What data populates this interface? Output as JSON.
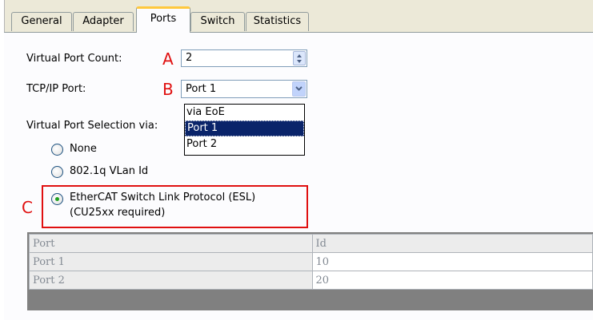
{
  "tabs": [
    "General",
    "Adapter",
    "Ports",
    "Switch",
    "Statistics"
  ],
  "active_tab": "Ports",
  "virtual_port_count": {
    "label": "Virtual Port Count:",
    "marker": "A",
    "value": "2"
  },
  "tcpip_port": {
    "label": "TCP/IP Port:",
    "marker": "B",
    "value": "Port 1"
  },
  "dropdown_options": [
    "via EoE",
    "Port 1",
    "Port 2"
  ],
  "dropdown_selected": "Port 1",
  "selection": {
    "label": "Virtual Port Selection via:",
    "options": [
      {
        "label": "None",
        "checked": false
      },
      {
        "label": "802.1q VLan Id",
        "checked": false
      },
      {
        "label": "EtherCAT Switch Link Protocol (ESL)",
        "sublabel": "(CU25xx required)",
        "checked": true,
        "marker": "C"
      }
    ]
  },
  "table": {
    "headers": [
      "Port",
      "Id"
    ],
    "rows": [
      [
        "Port 1",
        "10"
      ],
      [
        "Port 2",
        "20"
      ]
    ]
  },
  "colors": {
    "marker": "#e01010",
    "selected_item": "#0a246a",
    "active_tab_accent": "#ffc83c"
  }
}
